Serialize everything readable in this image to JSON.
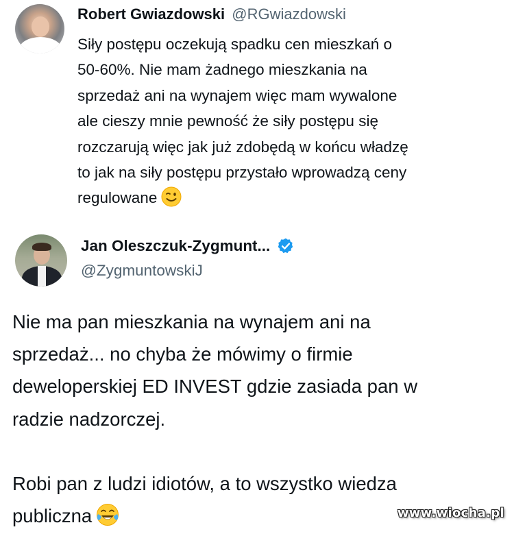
{
  "tweet1": {
    "display_name": "Robert Gwiazdowski",
    "handle": "@RGwiazdowski",
    "text_lines": [
      "Siły postępu oczekują spadku cen mieszkań o",
      "50-60%. Nie mam żadnego mieszkania na",
      "sprzedaż ani na wynajem więc mam wywalone",
      "ale cieszy mnie pewność że siły postępu się",
      "rozczarują więc jak już zdobędą w końcu władzę",
      "to jak na siły postępu przystało wprowadzą ceny",
      "regulowane"
    ],
    "emoji": "winking-face"
  },
  "tweet2": {
    "display_name": "Jan Oleszczuk-Zygmunt...",
    "handle": "@ZygmuntowskiJ",
    "verified": true,
    "paragraph1": [
      "Nie ma pan mieszkania na wynajem ani na",
      "sprzedaż... no chyba że mówimy o firmie",
      "deweloperskiej ED INVEST gdzie zasiada pan w",
      "radzie nadzorczej."
    ],
    "paragraph2": [
      "Robi pan z ludzi idiotów, a to wszystko wiedza",
      "publiczna"
    ],
    "emoji": "face-with-tears-of-joy"
  },
  "watermark": "www.wiocha.pl",
  "colors": {
    "text": "#0f1419",
    "secondary": "#536471",
    "verified": "#1d9bf0",
    "background": "#ffffff"
  }
}
